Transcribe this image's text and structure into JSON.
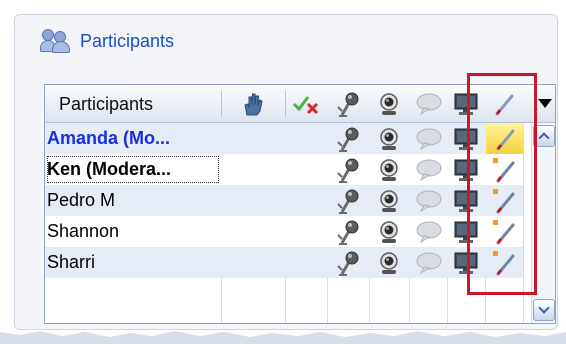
{
  "panel": {
    "title": "Participants",
    "title_icon": "people-icon"
  },
  "grid": {
    "header_name": "Participants",
    "columns": [
      {
        "key": "raise-hand",
        "icon": "raise-hand-icon"
      },
      {
        "key": "feedback",
        "icon": "check-x-icon"
      },
      {
        "key": "audio",
        "icon": "microphone-icon"
      },
      {
        "key": "video",
        "icon": "webcam-icon"
      },
      {
        "key": "chat",
        "icon": "chat-bubble-icon"
      },
      {
        "key": "share",
        "icon": "monitor-icon"
      },
      {
        "key": "annotate",
        "icon": "pen-icon"
      }
    ],
    "menu_icon": "dropdown-arrow-icon",
    "rows": [
      {
        "name": "Amanda (Mo...",
        "style": "moderator-blue",
        "annotate_active": true
      },
      {
        "name": "Ken (Modera...",
        "style": "moderator-black",
        "annotate_active": false
      },
      {
        "name": "Pedro M",
        "style": "normal",
        "annotate_active": false
      },
      {
        "name": "Shannon",
        "style": "normal",
        "annotate_active": false
      },
      {
        "name": "Sharri",
        "style": "normal",
        "annotate_active": false
      }
    ]
  },
  "colors": {
    "accent": "#1e4fc0",
    "highlight_box": "#c8192b",
    "row_alt": "#e5ecf6"
  }
}
